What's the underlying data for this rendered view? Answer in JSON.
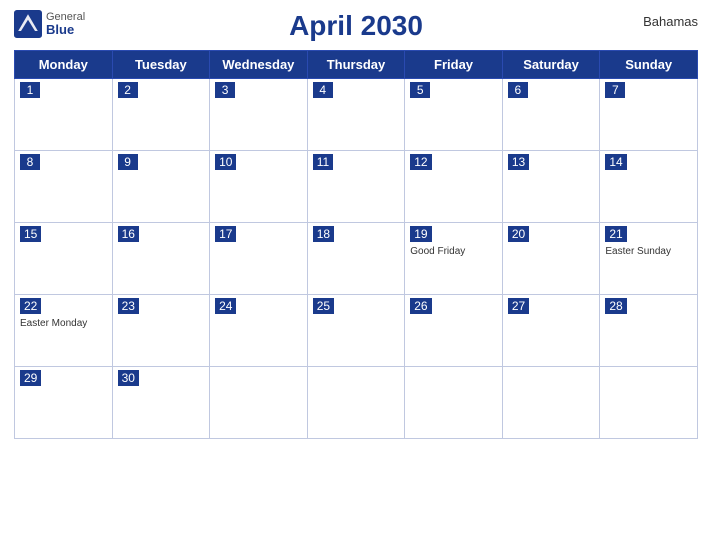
{
  "header": {
    "title": "April 2030",
    "country": "Bahamas",
    "logo": {
      "general": "General",
      "blue": "Blue"
    }
  },
  "weekdays": [
    "Monday",
    "Tuesday",
    "Wednesday",
    "Thursday",
    "Friday",
    "Saturday",
    "Sunday"
  ],
  "weeks": [
    [
      {
        "day": 1,
        "holiday": ""
      },
      {
        "day": 2,
        "holiday": ""
      },
      {
        "day": 3,
        "holiday": ""
      },
      {
        "day": 4,
        "holiday": ""
      },
      {
        "day": 5,
        "holiday": ""
      },
      {
        "day": 6,
        "holiday": ""
      },
      {
        "day": 7,
        "holiday": ""
      }
    ],
    [
      {
        "day": 8,
        "holiday": ""
      },
      {
        "day": 9,
        "holiday": ""
      },
      {
        "day": 10,
        "holiday": ""
      },
      {
        "day": 11,
        "holiday": ""
      },
      {
        "day": 12,
        "holiday": ""
      },
      {
        "day": 13,
        "holiday": ""
      },
      {
        "day": 14,
        "holiday": ""
      }
    ],
    [
      {
        "day": 15,
        "holiday": ""
      },
      {
        "day": 16,
        "holiday": ""
      },
      {
        "day": 17,
        "holiday": ""
      },
      {
        "day": 18,
        "holiday": ""
      },
      {
        "day": 19,
        "holiday": "Good Friday"
      },
      {
        "day": 20,
        "holiday": ""
      },
      {
        "day": 21,
        "holiday": "Easter Sunday"
      }
    ],
    [
      {
        "day": 22,
        "holiday": "Easter Monday"
      },
      {
        "day": 23,
        "holiday": ""
      },
      {
        "day": 24,
        "holiday": ""
      },
      {
        "day": 25,
        "holiday": ""
      },
      {
        "day": 26,
        "holiday": ""
      },
      {
        "day": 27,
        "holiday": ""
      },
      {
        "day": 28,
        "holiday": ""
      }
    ],
    [
      {
        "day": 29,
        "holiday": ""
      },
      {
        "day": 30,
        "holiday": ""
      },
      {
        "day": null,
        "holiday": ""
      },
      {
        "day": null,
        "holiday": ""
      },
      {
        "day": null,
        "holiday": ""
      },
      {
        "day": null,
        "holiday": ""
      },
      {
        "day": null,
        "holiday": ""
      }
    ]
  ]
}
